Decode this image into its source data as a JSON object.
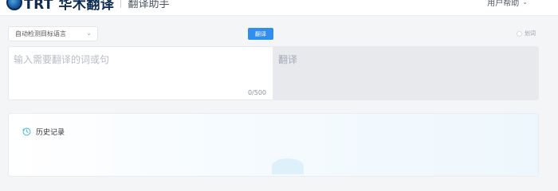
{
  "header": {
    "logo_text": "TRT 华木翻译",
    "sub_title": "翻译助手",
    "user_help": "用户帮助"
  },
  "toolbar": {
    "language_select": "自动检测目标语言",
    "translate_button": "翻译",
    "dict_toggle": "划词"
  },
  "source": {
    "placeholder": "输入需要翻译的词或句",
    "char_count": "0/500"
  },
  "target": {
    "placeholder": "翻译"
  },
  "history": {
    "title": "历史记录"
  },
  "colors": {
    "accent": "#2f8ef0",
    "page_bg": "#f4f5f7",
    "output_bg": "#e7e9ed"
  }
}
